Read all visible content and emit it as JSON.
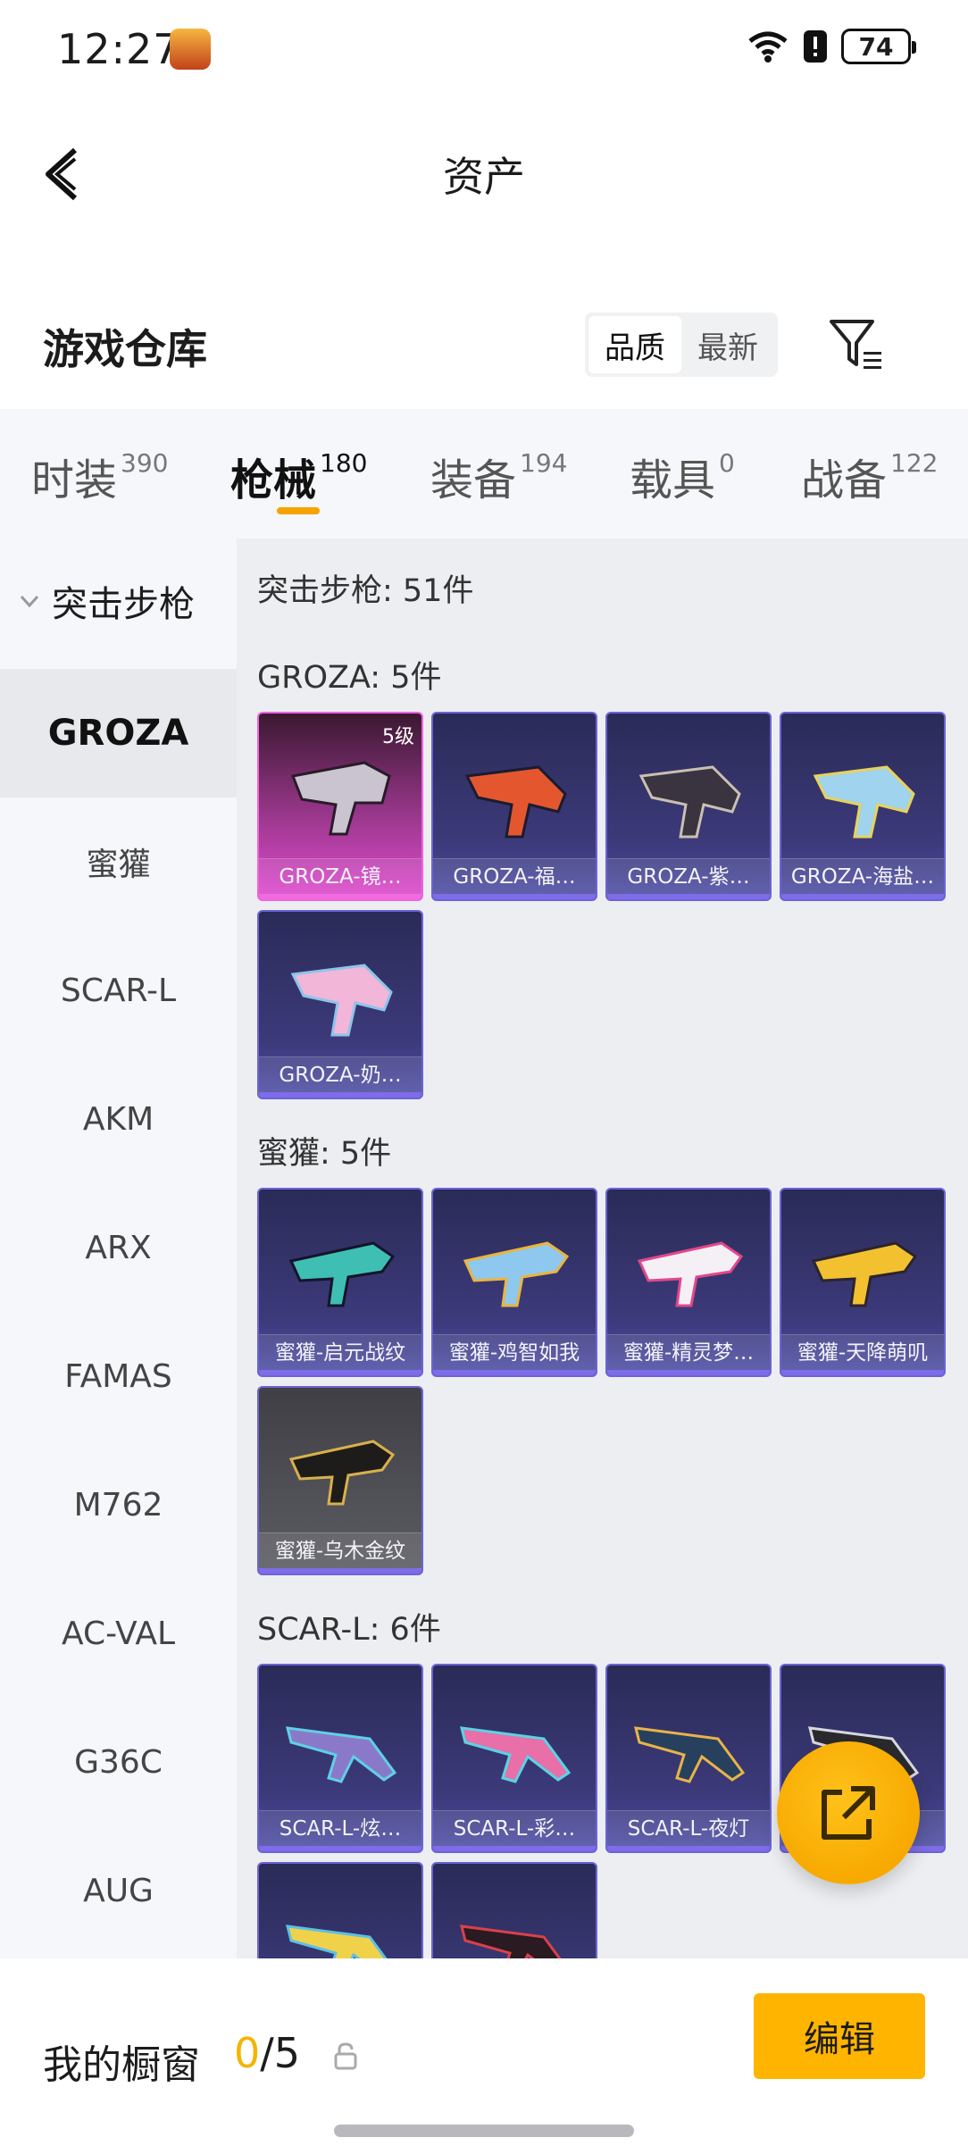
{
  "status_bar": {
    "time": "12:27",
    "battery": "74"
  },
  "header": {
    "title": "资产"
  },
  "warehouse": {
    "title": "游戏仓库",
    "sort_options": [
      "品质",
      "最新"
    ],
    "sort_selected": "品质"
  },
  "tabs": [
    {
      "label": "时装",
      "count": "390"
    },
    {
      "label": "枪械",
      "count": "180"
    },
    {
      "label": "装备",
      "count": "194"
    },
    {
      "label": "载具",
      "count": "0"
    },
    {
      "label": "战备",
      "count": "122"
    }
  ],
  "active_tab": "枪械",
  "sidebar": {
    "group": "突击步枪",
    "items": [
      "GROZA",
      "蜜獾",
      "SCAR-L",
      "AKM",
      "ARX",
      "FAMAS",
      "M762",
      "AC-VAL",
      "G36C",
      "AUG"
    ],
    "active": "GROZA"
  },
  "content": {
    "category_title": "突击步枪: 51件",
    "sections": [
      {
        "title": "GROZA: 5件",
        "items": [
          {
            "label": "GROZA-镜…",
            "level": "5级"
          },
          {
            "label": "GROZA-福…"
          },
          {
            "label": "GROZA-紫…"
          },
          {
            "label": "GROZA-海盐…"
          },
          {
            "label": "GROZA-奶…"
          }
        ]
      },
      {
        "title": "蜜獾: 5件",
        "items": [
          {
            "label": "蜜獾-启元战纹"
          },
          {
            "label": "蜜獾-鸡智如我"
          },
          {
            "label": "蜜獾-精灵梦…"
          },
          {
            "label": "蜜獾-天降萌叽"
          },
          {
            "label": "蜜獾-乌木金纹"
          }
        ]
      },
      {
        "title": "SCAR-L: 6件",
        "items": [
          {
            "label": "SCAR-L-炫…"
          },
          {
            "label": "SCAR-L-彩…"
          },
          {
            "label": "SCAR-L-夜灯"
          },
          {
            "label": "…"
          },
          {
            "label": ""
          },
          {
            "label": ""
          }
        ]
      }
    ]
  },
  "bottom": {
    "window_title": "我的橱窗",
    "count_current": "0",
    "count_total": "/5",
    "edit_label": "编辑"
  },
  "colors": {
    "accent": "#ffb400",
    "card_bg": "#3c3a7a",
    "card_border": "#6b64d6",
    "highlight_pink": "#e04ad0"
  },
  "icons": {
    "back": "chevron-left-icon",
    "filter": "filter-icon",
    "share": "share-icon",
    "lock": "lock-icon"
  }
}
